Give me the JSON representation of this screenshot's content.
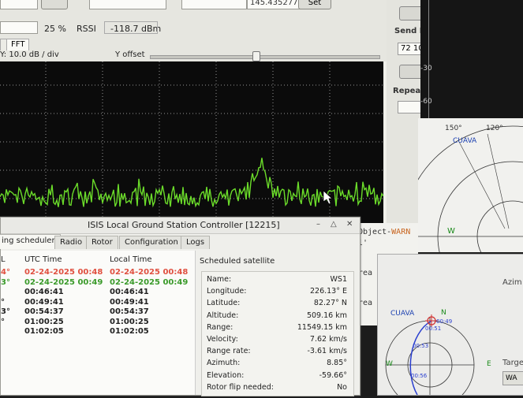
{
  "top": {
    "level_percent": "25 %",
    "rssi_label": "RSSI",
    "rssi_value": "-118.7 dBm",
    "freq_value": "145.435277",
    "set_label": "Set"
  },
  "plot": {
    "tab_fft": "FFT",
    "ydiv_label": "Y: 10.0 dB / div",
    "yoffset_label": "Y offset"
  },
  "right_panel": {
    "send_label": "Send I",
    "send_value": "72 10",
    "repeat_label": "Repea"
  },
  "terminal": {
    "line1_prefix": "Object-",
    "line1_warn": "WARN",
    "line2": "l'",
    "line3": "rea",
    "line4": "rea"
  },
  "dark_axis": {
    "tick1": "-30",
    "tick2": "-60"
  },
  "polar_upper": {
    "label_150": "150°",
    "label_120": "120°",
    "station": "CUAVA",
    "west": "W"
  },
  "polar_lower": {
    "station": "CUAVA",
    "north": "N",
    "west": "W",
    "east": "E",
    "azim_label": "Azim",
    "target_label": "Targe",
    "wa_label": "WA",
    "t1": "00:49",
    "t2": "00:51",
    "t3": "00:53",
    "t4": "00:56"
  },
  "dialog": {
    "title": "ISIS Local Ground Station Controller [12215]",
    "tabs": [
      "ing scheduler",
      "Radio",
      "Rotor",
      "Configuration",
      "Logs"
    ],
    "headers": {
      "col0": "L",
      "utc": "UTC Time",
      "local": "Local Time"
    },
    "rows": [
      {
        "col0": "4°",
        "utc": "02-24-2025 00:48",
        "local": "02-24-2025 00:48",
        "color": "#e05040"
      },
      {
        "col0": "3°",
        "utc": "02-24-2025 00:49",
        "local": "02-24-2025 00:49",
        "color": "#3a9a2a"
      },
      {
        "col0": "",
        "utc": "00:46:41",
        "local": "00:46:41",
        "color": "#222222"
      },
      {
        "col0": "°",
        "utc": "00:49:41",
        "local": "00:49:41",
        "color": "#222222"
      },
      {
        "col0": "3°",
        "utc": "00:54:37",
        "local": "00:54:37",
        "color": "#222222"
      },
      {
        "col0": "°",
        "utc": "01:00:25",
        "local": "01:00:25",
        "color": "#222222"
      },
      {
        "col0": "",
        "utc": "01:02:05",
        "local": "01:02:05",
        "color": "#222222"
      }
    ],
    "sat_title": "Scheduled satellite",
    "sat_fields": [
      {
        "k": "Name:",
        "v": "WS1"
      },
      {
        "k": "Longitude:",
        "v": "226.13° E"
      },
      {
        "k": "Latitude:",
        "v": "82.27° N"
      },
      {
        "k": "Altitude:",
        "v": "509.16 km"
      },
      {
        "k": "Range:",
        "v": "11549.15 km"
      },
      {
        "k": "Velocity:",
        "v": "7.62 km/s"
      },
      {
        "k": "Range rate:",
        "v": "-3.61 km/s"
      },
      {
        "k": "Azimuth:",
        "v": "8.85°"
      },
      {
        "k": "Elevation:",
        "v": "-59.66°"
      },
      {
        "k": "Rotor flip needed:",
        "v": "No"
      }
    ]
  }
}
